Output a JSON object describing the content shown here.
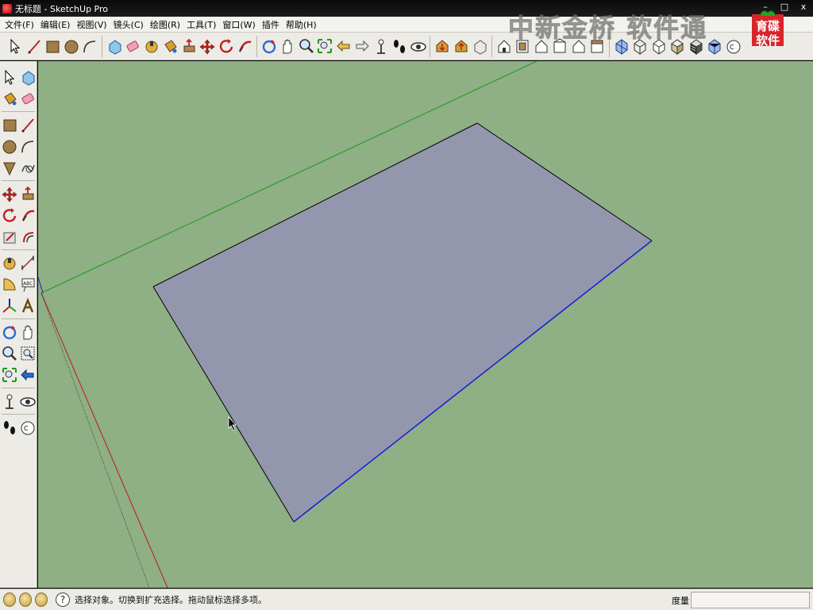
{
  "window": {
    "title": "无标题 - SketchUp Pro",
    "controls": [
      "–",
      "□",
      "x"
    ]
  },
  "menubar": {
    "items": [
      "文件(F)",
      "编辑(E)",
      "视图(V)",
      "镜头(C)",
      "绘图(R)",
      "工具(T)",
      "窗口(W)",
      "插件",
      "帮助(H)"
    ]
  },
  "watermark": {
    "text": "中新金桥  软件通",
    "badge_line1": "育碟",
    "badge_line2": "软件"
  },
  "toolbar": {
    "tools": [
      "select-icon",
      "line-icon",
      "rectangle-icon",
      "circle-icon",
      "arc-icon",
      "make-component-icon",
      "eraser-icon",
      "tape-measure-icon",
      "paint-bucket-icon",
      "push-pull-icon",
      "move-icon",
      "rotate-icon",
      "follow-me-icon",
      "orbit-icon",
      "pan-icon",
      "zoom-icon",
      "zoom-extents-icon",
      "previous-view-icon",
      "next-view-icon",
      "position-camera-icon",
      "walk-icon",
      "look-around-icon",
      "get-models-icon",
      "share-model-icon",
      "share-component-icon",
      "iso-view-icon",
      "top-view-icon",
      "front-view-icon",
      "right-view-icon",
      "back-view-icon",
      "left-view-icon",
      "xray-icon",
      "wireframe-icon",
      "hidden-line-icon",
      "shaded-icon",
      "shaded-textures-icon",
      "monochrome-icon",
      "section-plane-icon"
    ]
  },
  "lefttoolbar": {
    "tools": [
      "select-icon",
      "make-component-icon",
      "paint-bucket-icon",
      "eraser-icon",
      "rectangle-icon",
      "line-icon",
      "circle-icon",
      "arc-icon",
      "polygon-icon",
      "freehand-icon",
      "move-icon",
      "push-pull-icon",
      "rotate-icon",
      "follow-me-icon",
      "scale-icon",
      "offset-icon",
      "tape-measure-icon",
      "dimension-icon",
      "protractor-icon",
      "text-icon",
      "axes-icon",
      "3d-text-icon",
      "orbit-icon",
      "pan-icon",
      "zoom-icon",
      "zoom-window-icon",
      "zoom-extents-icon",
      "previous-icon",
      "position-camera-icon",
      "look-around-icon",
      "walk-icon",
      "section-plane-icon"
    ]
  },
  "status": {
    "message": "选择对象。切换到扩充选择。拖动鼠标选择多项。",
    "measure_label": "度量",
    "measure_value": ""
  },
  "colors": {
    "viewport_bg": "#8faf84",
    "face_fill": "#9397ae",
    "green_axis": "#1a9a1a",
    "red_axis": "#c01818",
    "blue_axis": "#1a1ad8"
  }
}
